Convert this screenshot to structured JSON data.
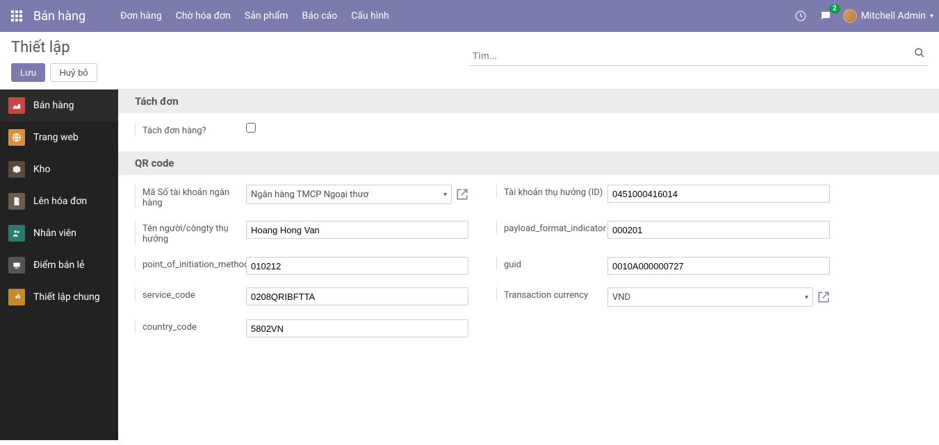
{
  "navbar": {
    "brand": "Bán hàng",
    "menu": [
      "Đơn hàng",
      "Chờ hóa đơn",
      "Sản phẩm",
      "Báo cáo",
      "Cấu hình"
    ],
    "message_badge": "2",
    "user_name": "Mitchell Admin"
  },
  "control": {
    "breadcrumb": "Thiết lập",
    "save": "Lưu",
    "discard": "Huỷ bỏ",
    "search_placeholder": "Tìm..."
  },
  "sidebar": {
    "items": [
      {
        "label": "Bán hàng",
        "icon": "chart"
      },
      {
        "label": "Trang web",
        "icon": "globe"
      },
      {
        "label": "Kho",
        "icon": "box"
      },
      {
        "label": "Lên hóa đơn",
        "icon": "doc"
      },
      {
        "label": "Nhân viên",
        "icon": "people"
      },
      {
        "label": "Điểm bán lẻ",
        "icon": "pos"
      },
      {
        "label": "Thiết lập chung",
        "icon": "gear"
      }
    ]
  },
  "sections": {
    "split": {
      "title": "Tách đơn",
      "field_label": "Tách đơn hàng?"
    },
    "qr": {
      "title": "QR code",
      "labels": {
        "bank_code": "Mã Số tài khoản ngân hàng",
        "beneficiary_id": "Tài khoản thụ hưởng (ID)",
        "beneficiary_name": "Tên người/côngty thụ hưởng",
        "payload_format_indicator": "payload_format_indicator",
        "point_of_initiation_method": "point_of_initiation_method",
        "guid": "guid",
        "service_code": "service_code",
        "transaction_currency": "Transaction currency",
        "country_code": "country_code"
      },
      "values": {
        "bank_code": "Ngân hàng TMCP Ngoại thươ",
        "beneficiary_id": "0451000416014",
        "beneficiary_name": "Hoang Hong Van",
        "payload_format_indicator": "000201",
        "point_of_initiation_method": "010212",
        "guid": "0010A000000727",
        "service_code": "0208QRIBFTTA",
        "transaction_currency": "VND",
        "country_code": "5802VN"
      }
    }
  }
}
